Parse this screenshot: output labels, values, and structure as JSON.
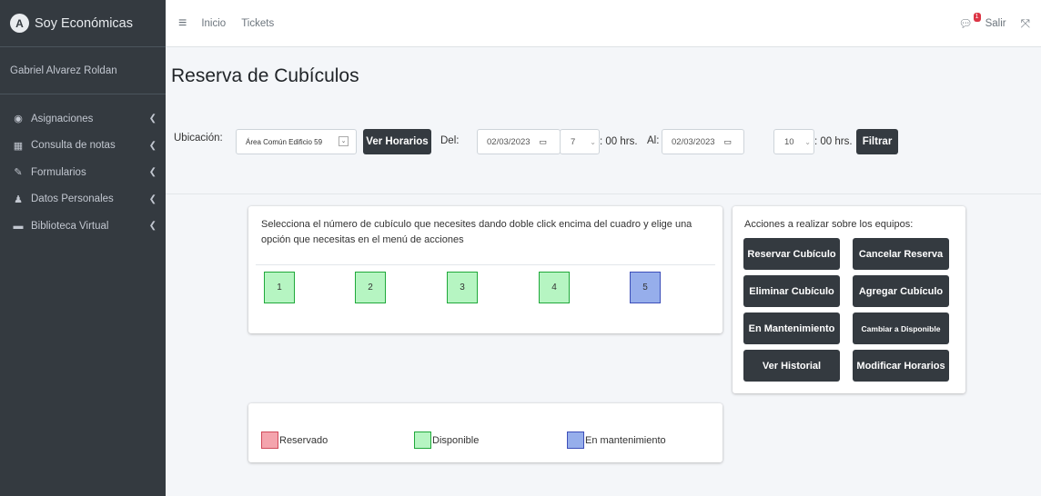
{
  "brand": {
    "logo_letter": "A",
    "name": "Soy Económicas"
  },
  "user": {
    "name": "Gabriel Alvarez Roldan"
  },
  "sidebar": {
    "items": [
      {
        "label": "Asignaciones",
        "icon": "tachometer-icon",
        "glyph": "◉"
      },
      {
        "label": "Consulta de notas",
        "icon": "grid-icon",
        "glyph": "▦"
      },
      {
        "label": "Formularios",
        "icon": "edit-icon",
        "glyph": "✎"
      },
      {
        "label": "Datos Personales",
        "icon": "user-icon",
        "glyph": "♟"
      },
      {
        "label": "Biblioteca Virtual",
        "icon": "book-icon",
        "glyph": "▬"
      }
    ]
  },
  "topbar": {
    "links": [
      "Inicio",
      "Tickets"
    ],
    "notification_count": "1",
    "logout": "Salir"
  },
  "page": {
    "title": "Reserva de Cubículos"
  },
  "filters": {
    "location_label": "Ubicación:",
    "location_value": "Área Común Edificio 59",
    "schedules_button": "Ver Horarios",
    "from_label": "Del:",
    "from_date": "02/03/2023",
    "from_hour": "7",
    "hrs_suffix": ": 00 hrs.",
    "to_label": "Al:",
    "to_date": "02/03/2023",
    "to_hour": "10",
    "filter_button": "Filtrar"
  },
  "cubicles": {
    "instructions": "Selecciona el número de cubículo que necesites dando doble click encima del cuadro y elige una opción que necesitas en el menú de acciones",
    "items": [
      {
        "number": "1",
        "status": "Disponible"
      },
      {
        "number": "2",
        "status": "Disponible"
      },
      {
        "number": "3",
        "status": "Disponible"
      },
      {
        "number": "4",
        "status": "Disponible"
      },
      {
        "number": "5",
        "status": "En mantenimiento"
      }
    ]
  },
  "actions": {
    "title": "Acciones a realizar sobre los equipos:",
    "buttons": [
      "Reservar Cubículo",
      "Cancelar Reserva",
      "Eliminar Cubículo",
      "Agregar Cubículo",
      "En Mantenimiento",
      "Cambiar a Disponible",
      "Ver Historial",
      "Modificar Horarios"
    ]
  },
  "legend": {
    "items": [
      {
        "label": "Reservado",
        "color": "#f4a4ad",
        "border": "#d04a5a"
      },
      {
        "label": "Disponible",
        "color": "#b6f5c2",
        "border": "#1fa83a"
      },
      {
        "label": "En mantenimiento",
        "color": "#96aeeb",
        "border": "#3c4eb9"
      }
    ]
  },
  "colors": {
    "sidebar_bg": "#343a40",
    "button_bg": "#343a40",
    "page_bg": "#f4f6f9"
  }
}
